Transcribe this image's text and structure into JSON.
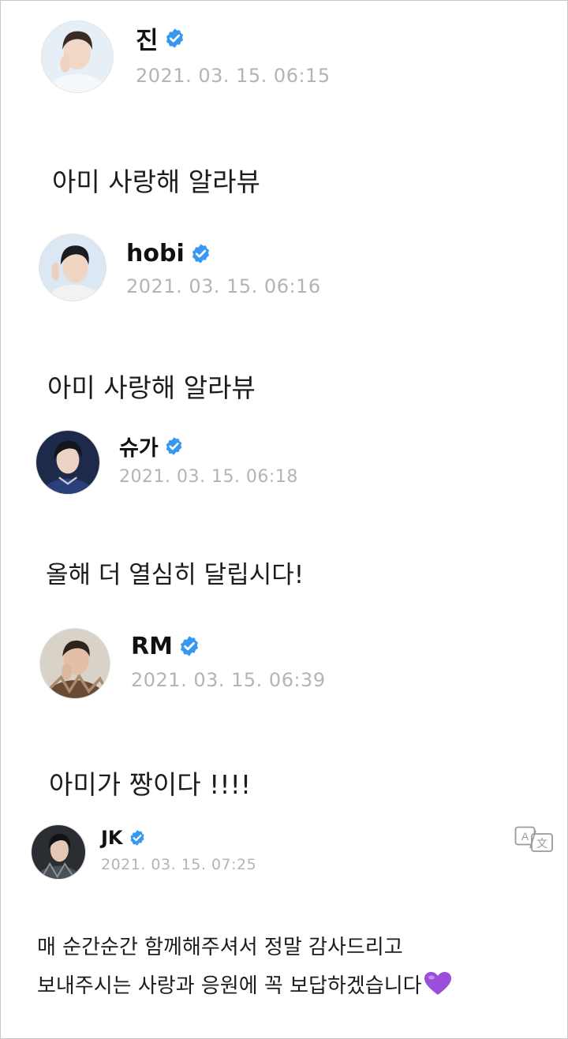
{
  "accent_color": "#3897f0",
  "verified_icon": "verified-badge-icon",
  "posts": [
    {
      "author": "진",
      "timestamp": "2021. 03. 15. 06:15",
      "message": "아미 사랑해 알라뷰",
      "avatar": "avatar-jin"
    },
    {
      "author": "hobi",
      "timestamp": "2021. 03. 15. 06:16",
      "message": "아미 사랑해 알라뷰",
      "avatar": "avatar-hobi"
    },
    {
      "author": "슈가",
      "timestamp": "2021. 03. 15. 06:18",
      "message": "올해 더 열심히 달립시다!",
      "avatar": "avatar-suga"
    },
    {
      "author": "RM",
      "timestamp": "2021. 03. 15. 06:39",
      "message": "아미가 짱이다 !!!!",
      "avatar": "avatar-rm"
    },
    {
      "author": "JK",
      "timestamp": "2021. 03. 15. 07:25",
      "message_line1": "매 순간순간 함께해주셔서 정말 감사드리고",
      "message_line2": "보내주시는 사랑과 응원에 꼭 보답하겠습니다",
      "message_emoji": "purple-heart",
      "translate_icon": "translate-icon",
      "avatar": "avatar-jk"
    }
  ]
}
